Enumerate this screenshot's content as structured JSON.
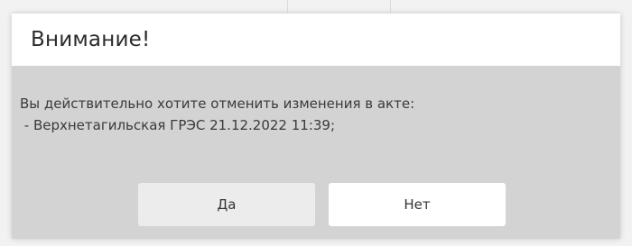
{
  "dialog": {
    "title": "Внимание!",
    "message_line1": "Вы действительно хотите отменить изменения в акте:",
    "message_line2": " - Верхнетагильская ГРЭС 21.12.2022 11:39;",
    "yes_label": "Да",
    "no_label": "Нет"
  },
  "colors": {
    "header_bg": "#ffffff",
    "body_bg": "#d3d3d3",
    "yes_button_bg": "#ececec",
    "no_button_bg": "#ffffff"
  }
}
